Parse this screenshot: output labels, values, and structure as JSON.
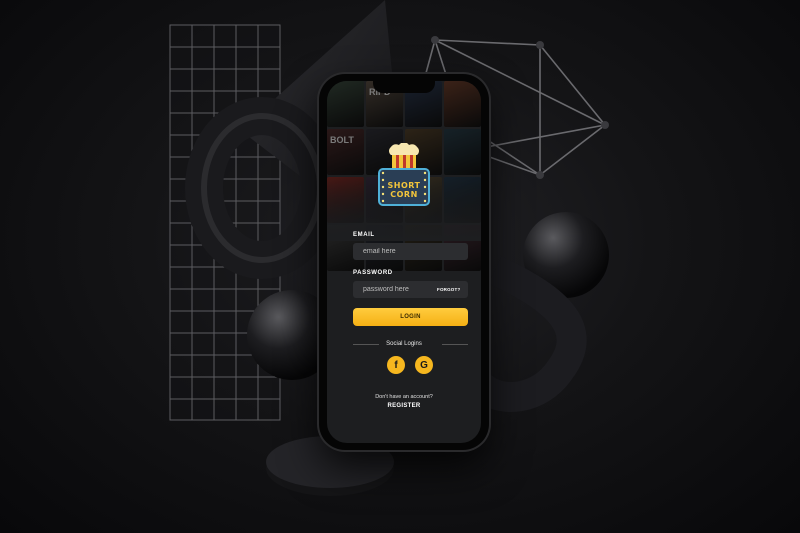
{
  "app": {
    "logo_text": [
      "SHORT",
      "CORN"
    ]
  },
  "login": {
    "email_label": "EMAIL",
    "email_placeholder": "email here",
    "password_label": "PASSWORD",
    "password_placeholder": "password here",
    "forgot_label": "FORGOT?",
    "login_button": "LOGIN"
  },
  "social": {
    "title": "Social Logins",
    "facebook_glyph": "f",
    "google_glyph": "G",
    "colors": {
      "button": "#f6b71f"
    }
  },
  "footer": {
    "no_account": "Don't have an account?",
    "register": "REGISTER"
  },
  "posters": {
    "visible_titles": [
      "RIPD",
      "BOLT"
    ],
    "colors": [
      "#3a4a3e",
      "#5b4f44",
      "#2d3a52",
      "#6a3d2b",
      "#4c2b2b",
      "#2f2f36",
      "#51402a",
      "#283c47",
      "#8a2b24",
      "#3c2e44",
      "#5e5036",
      "#23394c",
      "#444444",
      "#2b2f3a",
      "#3d3424",
      "#4a2f3a"
    ]
  },
  "theme": {
    "accent": "#f6b71f",
    "screen_bg": "#1d1e20"
  }
}
